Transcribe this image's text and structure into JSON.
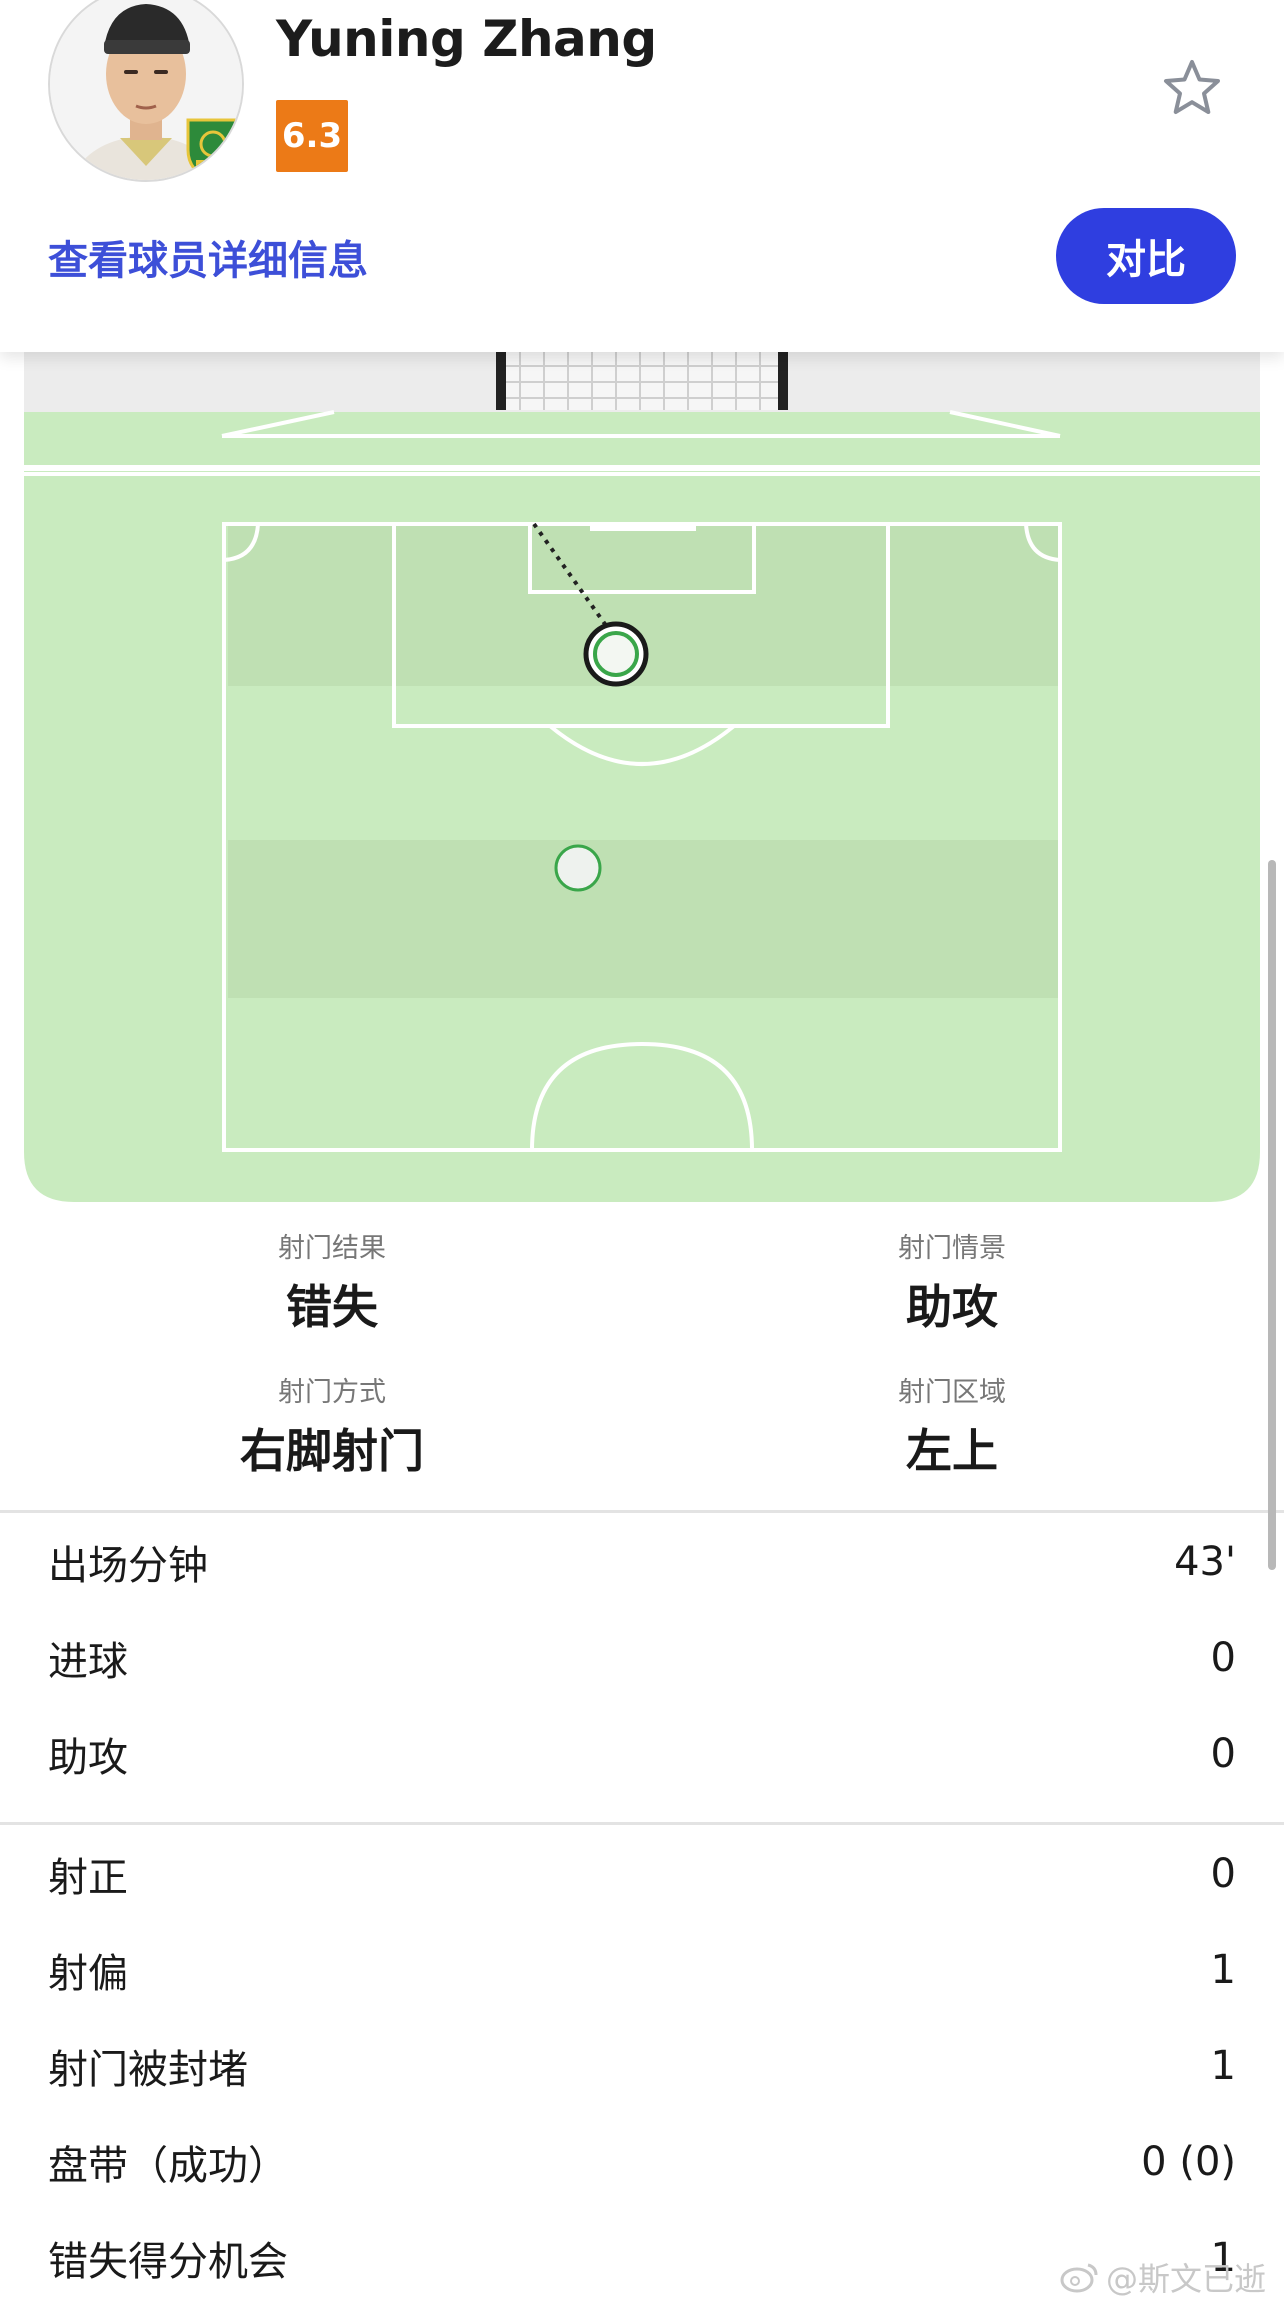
{
  "header": {
    "player_name": "Yuning Zhang",
    "rating": "6.3",
    "detail_link": "查看球员详细信息",
    "compare_label": "对比",
    "rating_color": "#ec7a17",
    "accent_color": "#2f3ee0"
  },
  "shot_info": [
    {
      "label": "射门结果",
      "value": "错失"
    },
    {
      "label": "射门情景",
      "value": "助攻"
    },
    {
      "label": "射门方式",
      "value": "右脚射门"
    },
    {
      "label": "射门区域",
      "value": "左上"
    }
  ],
  "stats_group_1": [
    {
      "label": "出场分钟",
      "value": "43'"
    },
    {
      "label": "进球",
      "value": "0"
    },
    {
      "label": "助攻",
      "value": "0"
    }
  ],
  "stats_group_2": [
    {
      "label": "射正",
      "value": "0"
    },
    {
      "label": "射偏",
      "value": "1"
    },
    {
      "label": "射门被封堵",
      "value": "1"
    },
    {
      "label": "盘带（成功）",
      "value": "0 (0)"
    },
    {
      "label": "错失得分机会",
      "value": "1"
    }
  ],
  "watermark": "@斯文已逝",
  "icons": [
    "star-outline-icon",
    "weibo-icon"
  ]
}
